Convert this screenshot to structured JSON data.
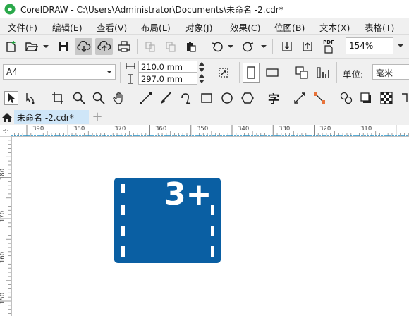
{
  "window": {
    "title": "CorelDRAW - C:\\Users\\Administrator\\Documents\\未命名 -2.cdr*"
  },
  "menu": [
    "文件(F)",
    "编辑(E)",
    "查看(V)",
    "布局(L)",
    "对象(J)",
    "效果(C)",
    "位图(B)",
    "文本(X)",
    "表格(T)"
  ],
  "toolbar": {
    "zoom": "154%",
    "pdf_label": "PDF"
  },
  "property_bar": {
    "page_size": "A4",
    "width": "210.0 mm",
    "height": "297.0 mm",
    "units_label": "单位:",
    "units_value": "毫米"
  },
  "tools": {
    "text_tool_glyph": "字"
  },
  "tabs": {
    "document": "未命名 -2.cdr*"
  },
  "ruler": {
    "h_ticks": [
      "390",
      "380",
      "370",
      "360",
      "350",
      "340",
      "330",
      "320",
      "310"
    ],
    "v_ticks": [
      "180",
      "170",
      "160",
      "150"
    ]
  },
  "artwork": {
    "text": "3+",
    "color": "#0a5fa3"
  },
  "colors": {
    "accent": "#0a5fa3",
    "tab_active": "#cfe6f8",
    "ruler_mark": "#1e90c8"
  }
}
